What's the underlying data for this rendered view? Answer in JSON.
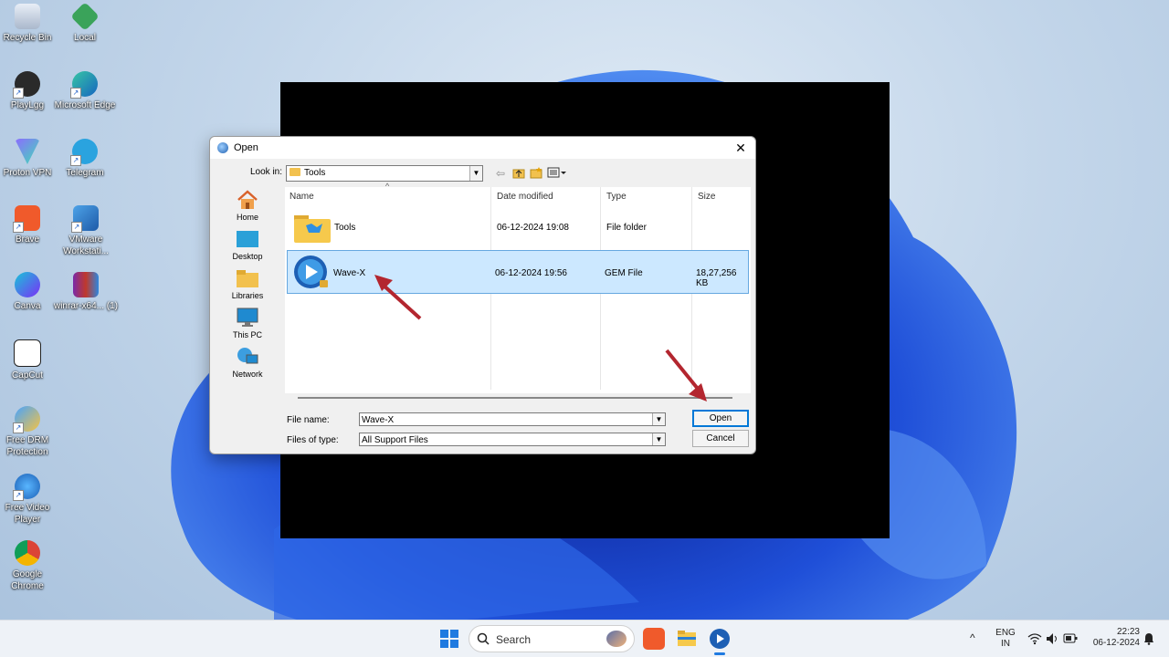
{
  "desktop": {
    "icons": [
      {
        "label": "Recycle Bin",
        "icon": "recycle-bin-icon"
      },
      {
        "label": "Local",
        "icon": "local-icon"
      },
      {
        "label": "PlayLgg",
        "icon": "playlgg-icon"
      },
      {
        "label": "Microsoft Edge",
        "icon": "edge-icon"
      },
      {
        "label": "Proton VPN",
        "icon": "proton-vpn-icon"
      },
      {
        "label": "Telegram",
        "icon": "telegram-icon"
      },
      {
        "label": "Brave",
        "icon": "brave-icon"
      },
      {
        "label": "VMware Workstati...",
        "icon": "vmware-icon"
      },
      {
        "label": "Canva",
        "icon": "canva-icon"
      },
      {
        "label": "winrar-x64... (1)",
        "icon": "winrar-icon"
      },
      {
        "label": "CapCut",
        "icon": "capcut-icon"
      },
      {
        "label": "Free DRM Protection",
        "icon": "free-drm-icon"
      },
      {
        "label": "Free Video Player",
        "icon": "free-video-player-icon"
      },
      {
        "label": "Google Chrome",
        "icon": "chrome-icon"
      }
    ]
  },
  "dialog": {
    "title": "Open",
    "close": "✕",
    "look_in_label": "Look in:",
    "look_in_value": "Tools",
    "places": [
      {
        "label": "Home",
        "icon": "home-icon"
      },
      {
        "label": "Desktop",
        "icon": "desktop-icon"
      },
      {
        "label": "Libraries",
        "icon": "libraries-icon"
      },
      {
        "label": "This PC",
        "icon": "this-pc-icon"
      },
      {
        "label": "Network",
        "icon": "network-icon"
      }
    ],
    "columns": {
      "name": "Name",
      "date": "Date modified",
      "type": "Type",
      "size": "Size"
    },
    "files": [
      {
        "name": "Tools",
        "date": "06-12-2024 19:08",
        "type": "File folder",
        "size": ""
      },
      {
        "name": "Wave-X",
        "date": "06-12-2024 19:56",
        "type": "GEM File",
        "size": "18,27,256 KB"
      }
    ],
    "file_name_label": "File name:",
    "file_name_value": "Wave-X",
    "file_type_label": "Files of type:",
    "file_type_value": "All Support Files",
    "open_button": "Open",
    "cancel_button": "Cancel"
  },
  "taskbar": {
    "search_placeholder": "Search",
    "lang_top": "ENG",
    "lang_bottom": "IN",
    "time": "22:23",
    "date": "06-12-2024"
  },
  "colors": {
    "accent": "#0078d7",
    "arrow": "#b3262f",
    "selection": "#cce8ff"
  }
}
